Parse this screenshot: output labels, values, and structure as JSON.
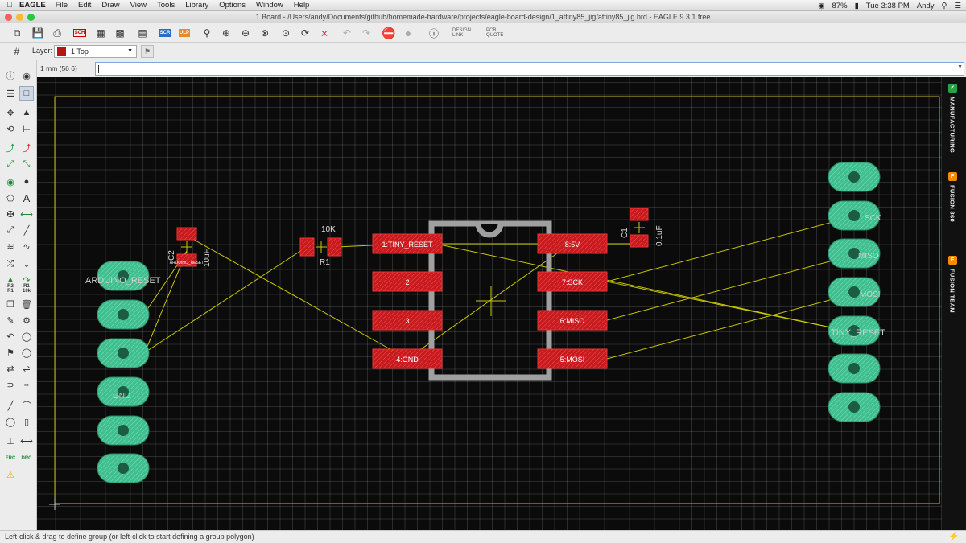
{
  "menubar": {
    "app_name": "EAGLE",
    "items": [
      "File",
      "Edit",
      "Draw",
      "View",
      "Tools",
      "Library",
      "Options",
      "Window",
      "Help"
    ],
    "battery": "87%",
    "clock": "Tue 3:38 PM",
    "user": "Andy"
  },
  "window": {
    "title": "1 Board - /Users/andy/Documents/github/homemade-hardware/projects/eagle-board-design/1_attiny85_jig/attiny85_jig.brd - EAGLE 9.3.1 free"
  },
  "toolbar": {
    "script_label": "SCR",
    "ulp_label": "ULP",
    "sch_label": "SCH",
    "design_link_label": "DESIGN LINK",
    "pcb_quote_label": "PCB QUOTE"
  },
  "layer": {
    "label": "Layer:",
    "selected": "1 Top",
    "color": "#b51515"
  },
  "command": {
    "coordinate": "1 mm (56 6)",
    "value": ""
  },
  "side_panel": {
    "tabs": [
      {
        "label": "MANUFACTURING",
        "icon": "manufacturing-icon",
        "color": "#2f9e44"
      },
      {
        "label": "FUSION 360",
        "icon": "fusion-icon",
        "color": "#f08c00"
      },
      {
        "label": "FUSION TEAM",
        "icon": "fusion-team-icon",
        "color": "#f08c00"
      }
    ]
  },
  "board": {
    "ic_pads": {
      "left": [
        "1:TINY_RESET",
        "2",
        "3",
        "4:GND"
      ],
      "right": [
        "8:5V",
        "7:SCK",
        "6:MISO",
        "5:MOSI"
      ]
    },
    "components": {
      "r1_name": "R1",
      "r1_value": "10K",
      "c1_name": "C1",
      "c1_value": "0.1uF",
      "c2_name": "C2",
      "c2_value": "10uF",
      "c2_pad_label": "ARDUINO_RESET"
    },
    "left_header_labels": [
      "ARDUINO_RESET",
      "GND"
    ],
    "right_header_labels": [
      "SCK",
      "MISO",
      "MOSI",
      "TINY_RESET"
    ],
    "colors": {
      "background": "#0b0b0b",
      "copper_top": "#c8191c",
      "pads": "#3fbf8f",
      "airwires": "#c8c800",
      "silkscreen": "#a0a0a0"
    }
  },
  "status": {
    "message": "Left-click & drag to define group (or left-click to start defining a group polygon)"
  }
}
